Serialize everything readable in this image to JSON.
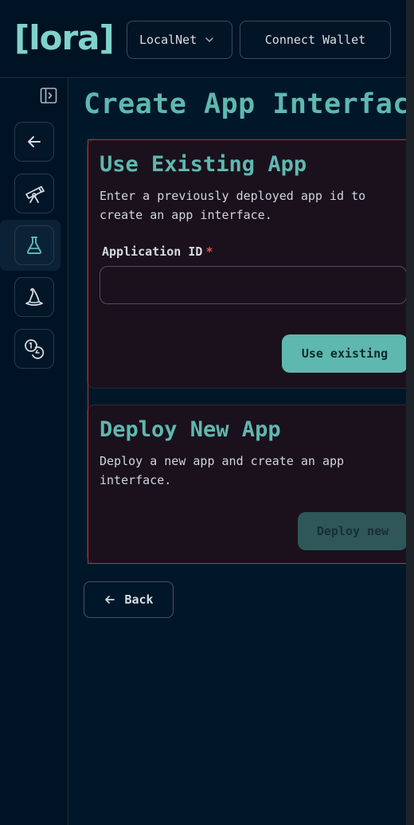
{
  "header": {
    "logo": "[lora]",
    "network_select": {
      "value": "LocalNet",
      "icon": "chevron-down-icon"
    },
    "connect_wallet_label": "Connect Wallet"
  },
  "sidebar": {
    "items": [
      {
        "name": "back",
        "icon": "arrow-left-icon"
      },
      {
        "name": "explore",
        "icon": "telescope-icon"
      },
      {
        "name": "app-lab",
        "icon": "flask-icon",
        "active": true
      },
      {
        "name": "transaction-wizard",
        "icon": "wizard-hat-icon"
      },
      {
        "name": "fund",
        "icon": "coins-icon"
      }
    ],
    "theme_toggle_icon": "moon-icon",
    "collapse_icon": "panel-toggle-icon"
  },
  "main": {
    "title": "Create App Interface",
    "existing_card": {
      "title": "Use Existing App",
      "description": "Enter a previously deployed app id to create an app interface.",
      "field_label": "Application ID",
      "required_marker": "*",
      "input_value": "",
      "button_label": "Use existing"
    },
    "deploy_card": {
      "title": "Deploy New App",
      "description": "Deploy a new app and create an app interface.",
      "button_label": "Deploy new"
    },
    "back_label": "Back"
  },
  "colors": {
    "accent": "#5fb8b0",
    "background": "#001324",
    "card": "#1a111c",
    "required": "#e0574d"
  }
}
